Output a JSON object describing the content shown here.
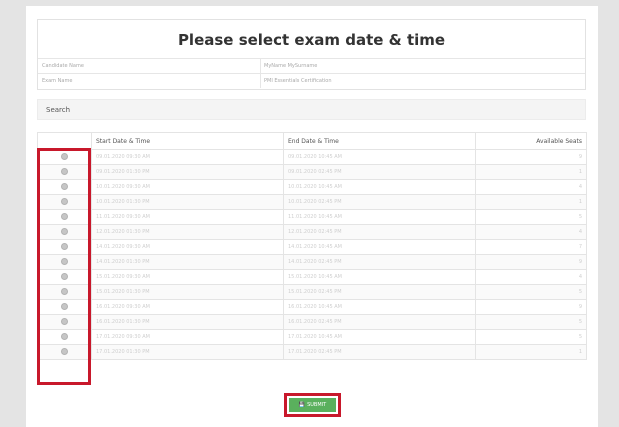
{
  "header": {
    "title": "Please select exam date & time",
    "candidate_label": "Candidate Name",
    "candidate_value": "MyName MySurname",
    "exam_label": "Exam Name",
    "exam_value": "PMI Essentials Certification"
  },
  "search": {
    "label": "Search"
  },
  "table": {
    "columns": [
      "",
      "Start Date & Time",
      "End Date & Time",
      "Available Seats"
    ],
    "rows": [
      {
        "start": "09.01.2020 09:30 AM",
        "end": "09.01.2020 10:45 AM",
        "seats": "9"
      },
      {
        "start": "09.01.2020 01:30 PM",
        "end": "09.01.2020 02:45 PM",
        "seats": "1"
      },
      {
        "start": "10.01.2020 09:30 AM",
        "end": "10.01.2020 10:45 AM",
        "seats": "4"
      },
      {
        "start": "10.01.2020 01:30 PM",
        "end": "10.01.2020 02:45 PM",
        "seats": "1"
      },
      {
        "start": "11.01.2020 09:30 AM",
        "end": "11.01.2020 10:45 AM",
        "seats": "5"
      },
      {
        "start": "12.01.2020 01:30 PM",
        "end": "12.01.2020 02:45 PM",
        "seats": "4"
      },
      {
        "start": "14.01.2020 09:30 AM",
        "end": "14.01.2020 10:45 AM",
        "seats": "7"
      },
      {
        "start": "14.01.2020 01:30 PM",
        "end": "14.01.2020 02:45 PM",
        "seats": "9"
      },
      {
        "start": "15.01.2020 09:30 AM",
        "end": "15.01.2020 10:45 AM",
        "seats": "4"
      },
      {
        "start": "15.01.2020 01:30 PM",
        "end": "15.01.2020 02:45 PM",
        "seats": "5"
      },
      {
        "start": "16.01.2020 09:30 AM",
        "end": "16.01.2020 10:45 AM",
        "seats": "9"
      },
      {
        "start": "16.01.2020 01:30 PM",
        "end": "16.01.2020 02:45 PM",
        "seats": "5"
      },
      {
        "start": "17.01.2020 09:30 AM",
        "end": "17.01.2020 10:45 AM",
        "seats": "5"
      },
      {
        "start": "17.01.2020 01:30 PM",
        "end": "17.01.2020 02:45 PM",
        "seats": "1"
      }
    ]
  },
  "submit": {
    "label": "SUBMIT",
    "icon": "save-icon"
  },
  "colors": {
    "highlight": "#c8182b",
    "submit_bg": "#5ab05d"
  }
}
